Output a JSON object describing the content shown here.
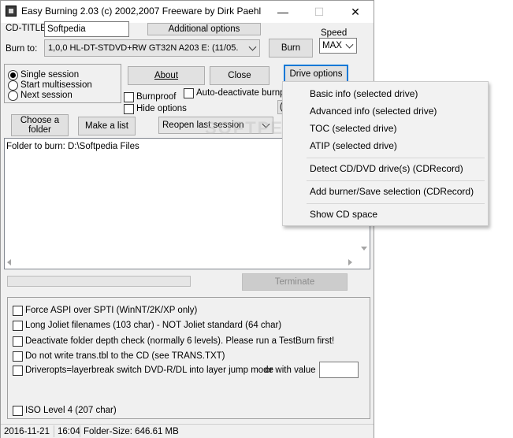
{
  "window": {
    "title": "Easy Burning 2.03 (c) 2002,2007 Freeware by Dirk Paehl",
    "minimize": "—",
    "maximize": "☐",
    "close": "✕"
  },
  "top": {
    "cd_title_label": "CD-TITLE",
    "cd_title_value": "Softpedia",
    "additional_options": "Additional options",
    "burn_to_label": "Burn to:",
    "burn_to_value": "1,0,0 HL-DT-STDVD+RW GT32N   A203 E: (11/05.",
    "burn_button": "Burn",
    "speed_label": "Speed",
    "speed_value": "MAX"
  },
  "session": {
    "single": "Single session",
    "multi": "Start multisession",
    "next": "Next session"
  },
  "buttons": {
    "about": "About",
    "close": "Close",
    "drive_options": "Drive options",
    "choose_folder": "Choose a folder",
    "make_list": "Make a list",
    "terminate": "Terminate"
  },
  "checks": {
    "burnproof": "Burnproof",
    "hide_options": "Hide options",
    "auto_deactivate": "Auto-deactivate burnpro"
  },
  "reopen": {
    "value": "Reopen last session"
  },
  "content": {
    "folder_line": "Folder to burn: D:\\Softpedia Files"
  },
  "options": {
    "force_aspi": "Force ASPI over SPTI (WinNT/2K/XP only)",
    "long_joliet": "Long Joliet filenames (103 char) - NOT Joliet standard (64 char)",
    "deactivate_depth": "Deactivate folder depth check (normally 6 levels). Please run a TestBurn first!",
    "no_trans": "Do not write trans.tbl to the CD (see TRANS.TXT)",
    "driveropts": "Driveropts=layerbreak switch  DVD-R/DL into layer jump mode",
    "with_value": "or with value",
    "iso_level4": "ISO Level 4 (207 char)"
  },
  "status": {
    "date": "2016-11-21",
    "time": "16:04",
    "folder_size": "Folder-Size: 646.61 MB"
  },
  "menu": {
    "items": [
      "Basic info (selected drive)",
      "Advanced info (selected drive)",
      "TOC (selected drive)",
      "ATIP (selected drive)",
      "Detect CD/DVD drive(s) (CDRecord)",
      "Add burner/Save selection (CDRecord)",
      "Show CD space"
    ]
  },
  "watermark": "SOFTPEDIA"
}
